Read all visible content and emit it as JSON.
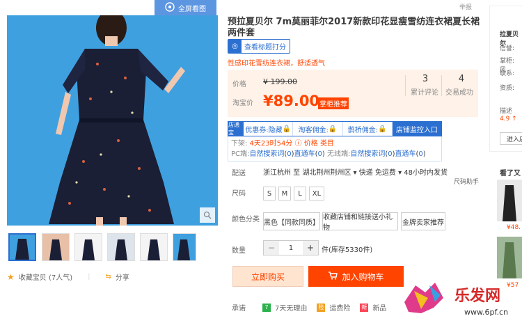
{
  "fullscreen_label": "全屏看图",
  "report_label": "举报",
  "title": "预拉夏贝尔 7m莫丽菲尔2017新款印花显瘦雪纺连衣裙夏长裙两件套",
  "check_title_btn": "查看标题打分",
  "subtitle": "性感印花雪纺连衣裙，舒适透气",
  "price": {
    "orig_label": "价格",
    "orig_value": "¥ 199.00",
    "taobao_label": "淘宝价",
    "taobao_value": "¥89.00",
    "tag": "掌柜推荐",
    "reviews_count": "3",
    "reviews_label": "累计评论",
    "deals_count": "4",
    "deals_label": "交易成功"
  },
  "coupon": {
    "logo": "店通宝",
    "tabs": [
      "优惠券:隐藏",
      "淘客佣金:",
      "鹊桥佣金:",
      "店铺监控入口"
    ],
    "line1_prefix": "下架:",
    "line1_time": "4天23时54分",
    "line1_price": "价格",
    "line1_category": "类目",
    "line2_pc": "PC端:",
    "line2_pc_search": "自然搜索词",
    "line2_pc_search_count": "0",
    "line2_pc_direct": "直通车",
    "line2_pc_direct_count": "0",
    "line2_wireless": "无线端:",
    "line2_wl_search": "自然搜索词",
    "line2_wl_search_count": "0",
    "line2_wl_direct": "直通车",
    "line2_wl_direct_count": "0"
  },
  "shipping": {
    "label": "配送",
    "text": "浙江杭州 至 湖北荆州荆州区 ▾  快递 免运费 ▾  48小时内发货"
  },
  "size": {
    "label": "尺码",
    "helper": "尺码助手",
    "options": [
      "S",
      "M",
      "L",
      "XL"
    ]
  },
  "color": {
    "label": "颜色分类",
    "options": [
      "黑色【同款同质】",
      "收藏店铺和链接送小礼物",
      "金牌卖家推荐"
    ]
  },
  "quantity": {
    "label": "数量",
    "minus": "−",
    "value": "1",
    "plus": "+",
    "stock": "件(库存5330件)"
  },
  "buy_now": "立即购买",
  "add_cart": "加入购物车",
  "promise": {
    "label": "承诺",
    "items": [
      "7天无理由",
      "运费险",
      "新品"
    ]
  },
  "favorite": "收藏宝贝 (7人气)",
  "share": "分享",
  "sidebar": {
    "shop_name": "拉夏贝尔",
    "credit": "信誉:",
    "keeper": "掌柜: 风",
    "contact": "联系:",
    "quals": "资质:",
    "desc_label": "描述",
    "desc_score": "4.9 ↑",
    "enter": "进入店",
    "also_viewed": "看了又看",
    "also_price": "¥48.",
    "also_price2": "¥57"
  },
  "watermark_text": "乐发网",
  "watermark_url": "www.6pf.cn",
  "colors": {
    "accent": "#ff4400",
    "blue": "#2b6fd0",
    "price_bg": "#fff2e8"
  }
}
